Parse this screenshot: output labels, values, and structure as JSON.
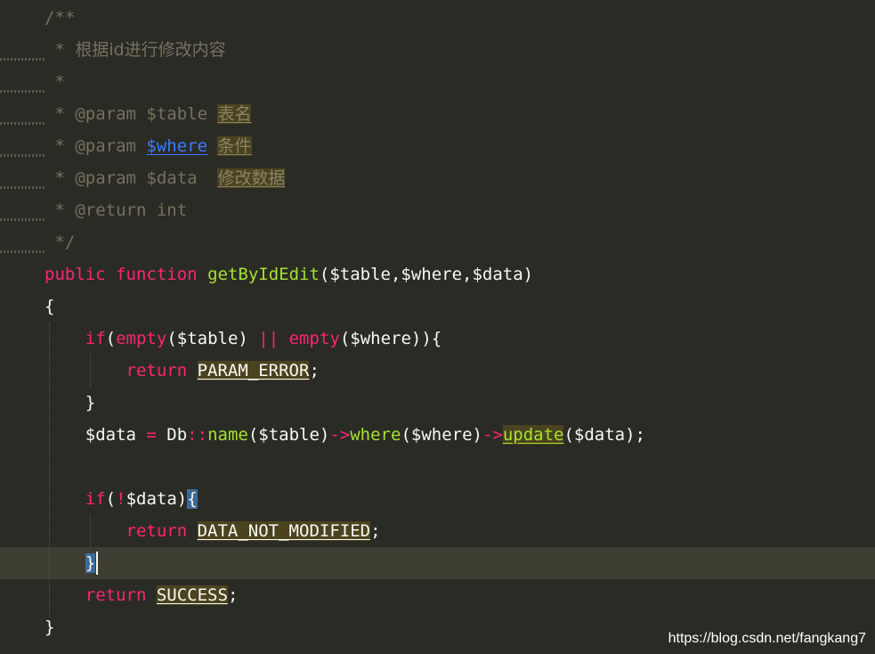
{
  "editor": {
    "theme_colors": {
      "background": "#2b2b26",
      "comment": "#75715e",
      "keyword": "#f92672",
      "function": "#a6e22e",
      "text": "#f8f8f2",
      "highlight_bg": "#4b4320",
      "current_line": "#3e3d32",
      "bracket_match": "#3c6b9a",
      "link": "#3a7bff"
    },
    "lines": {
      "l1": {
        "t1": "/**"
      },
      "l2": {
        "t1": " * ",
        "t2": "根据id进行修改内容"
      },
      "l3": {
        "t1": " *"
      },
      "l4": {
        "t1": " * @param $table ",
        "t2": "表名"
      },
      "l5": {
        "t1": " * @param ",
        "t2": "$where",
        "t3": " ",
        "t4": "条件"
      },
      "l6": {
        "t1": " * @param $data  ",
        "t2": "修改数据"
      },
      "l7": {
        "t1": " * @return int"
      },
      "l8": {
        "t1": " */"
      },
      "l9": {
        "t1": "public",
        "t2": " ",
        "t3": "function",
        "t4": " ",
        "t5": "getByIdEdit",
        "t6": "($table,$where,$data)"
      },
      "l10": {
        "t1": "{"
      },
      "l11": {
        "t1": "    ",
        "t2": "if",
        "t3": "(",
        "t4": "empty",
        "t5": "($table) ",
        "t6": "||",
        "t7": " ",
        "t8": "empty",
        "t9": "($where)){"
      },
      "l12": {
        "t1": "        ",
        "t2": "return",
        "t3": " ",
        "t4": "PARAM_ERROR",
        "t5": ";"
      },
      "l13": {
        "t1": "    }"
      },
      "l14": {
        "t1": "    $data ",
        "t2": "=",
        "t3": " Db",
        "t4": "::",
        "t5": "name",
        "t6": "($table)",
        "t7": "->",
        "t8": "where",
        "t9": "($where)",
        "t10": "->",
        "t11": "update",
        "t12": "($data);"
      },
      "l15": {
        "t1": ""
      },
      "l16": {
        "t1": "    ",
        "t2": "if",
        "t3": "(",
        "t4": "!",
        "t5": "$data)",
        "t6": "{"
      },
      "l17": {
        "t1": "        ",
        "t2": "return",
        "t3": " ",
        "t4": "DATA_NOT_MODIFIED",
        "t5": ";"
      },
      "l18": {
        "t1": "    ",
        "t2": "}"
      },
      "l19": {
        "t1": "    ",
        "t2": "return",
        "t3": " ",
        "t4": "SUCCESS",
        "t5": ";"
      },
      "l20": {
        "t1": "}"
      }
    }
  },
  "watermark": "https://blog.csdn.net/fangkang7"
}
